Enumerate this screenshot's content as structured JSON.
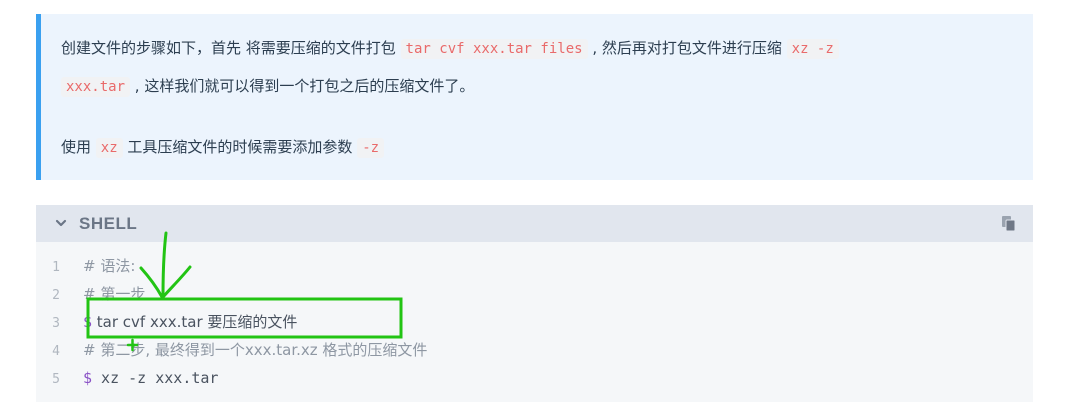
{
  "tip": {
    "line1_a": "创建文件的步骤如下，首先 将需要压缩的文件打包 ",
    "line1_code1": "tar cvf xxx.tar files",
    "line1_b": " , 然后再对打包文件进行压缩 ",
    "line1_code2": "xz -z",
    "line2_code": "xxx.tar",
    "line2_b": " , 这样我们就可以得到一个打包之后的压缩文件了。",
    "line3_a": "使用 ",
    "line3_code1": "xz",
    "line3_b": " 工具压缩文件的时候需要添加参数 ",
    "line3_code2": "-z"
  },
  "code": {
    "language": "SHELL",
    "lines": [
      {
        "num": "1",
        "text": "# 语法:"
      },
      {
        "num": "2",
        "text": "# 第一步"
      },
      {
        "num": "3",
        "prompt": "$",
        "text": " tar cvf xxx.tar 要压缩的文件"
      },
      {
        "num": "4",
        "text": "# 第二步, 最终得到一个xxx.tar.xz 格式的压缩文件"
      },
      {
        "num": "5",
        "prompt": "$",
        "text": " xz -z xxx.tar"
      }
    ]
  },
  "icons": {
    "collapse": "chevron-down-icon",
    "copy": "copy-icon"
  },
  "colors": {
    "tip_bg": "#ecf4fd",
    "tip_border": "#3aa0f0",
    "inline_code": "#e96a6a",
    "annotation": "#22c414"
  }
}
